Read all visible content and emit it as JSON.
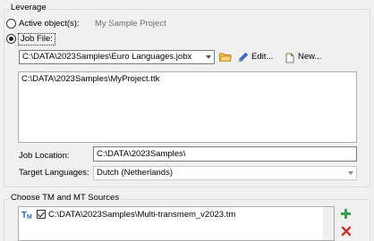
{
  "leverage": {
    "group_title": "Leverage",
    "active_object_label": "Active object(s):",
    "active_object_value": "My Sample Project",
    "job_file_label": "Job File:",
    "job_file_path": "C:\\DATA\\2023Samples\\Euro Languages.jobx",
    "edit_label": "Edit...",
    "new_label": "New...",
    "project_list_item": "C:\\DATA\\2023Samples\\MyProject.ttk",
    "job_location_label": "Job Location:",
    "job_location_value": "C:\\DATA\\2023Samples\\",
    "target_languages_label": "Target Languages:",
    "target_languages_value": "Dutch (Netherlands)"
  },
  "sources": {
    "group_title": "Choose TM and MT Sources",
    "items": [
      {
        "label": "C:\\DATA\\2023Samples\\Multi-transmem_v2023.tm",
        "checked": true,
        "icon": "tm-icon"
      }
    ],
    "add_icon": "plus-icon",
    "remove_icon": "close-icon"
  },
  "colors": {
    "add": "#3aa14a",
    "remove": "#d0312d",
    "folder": "#e8a33c",
    "tm_icon": "#2f6fb5"
  }
}
